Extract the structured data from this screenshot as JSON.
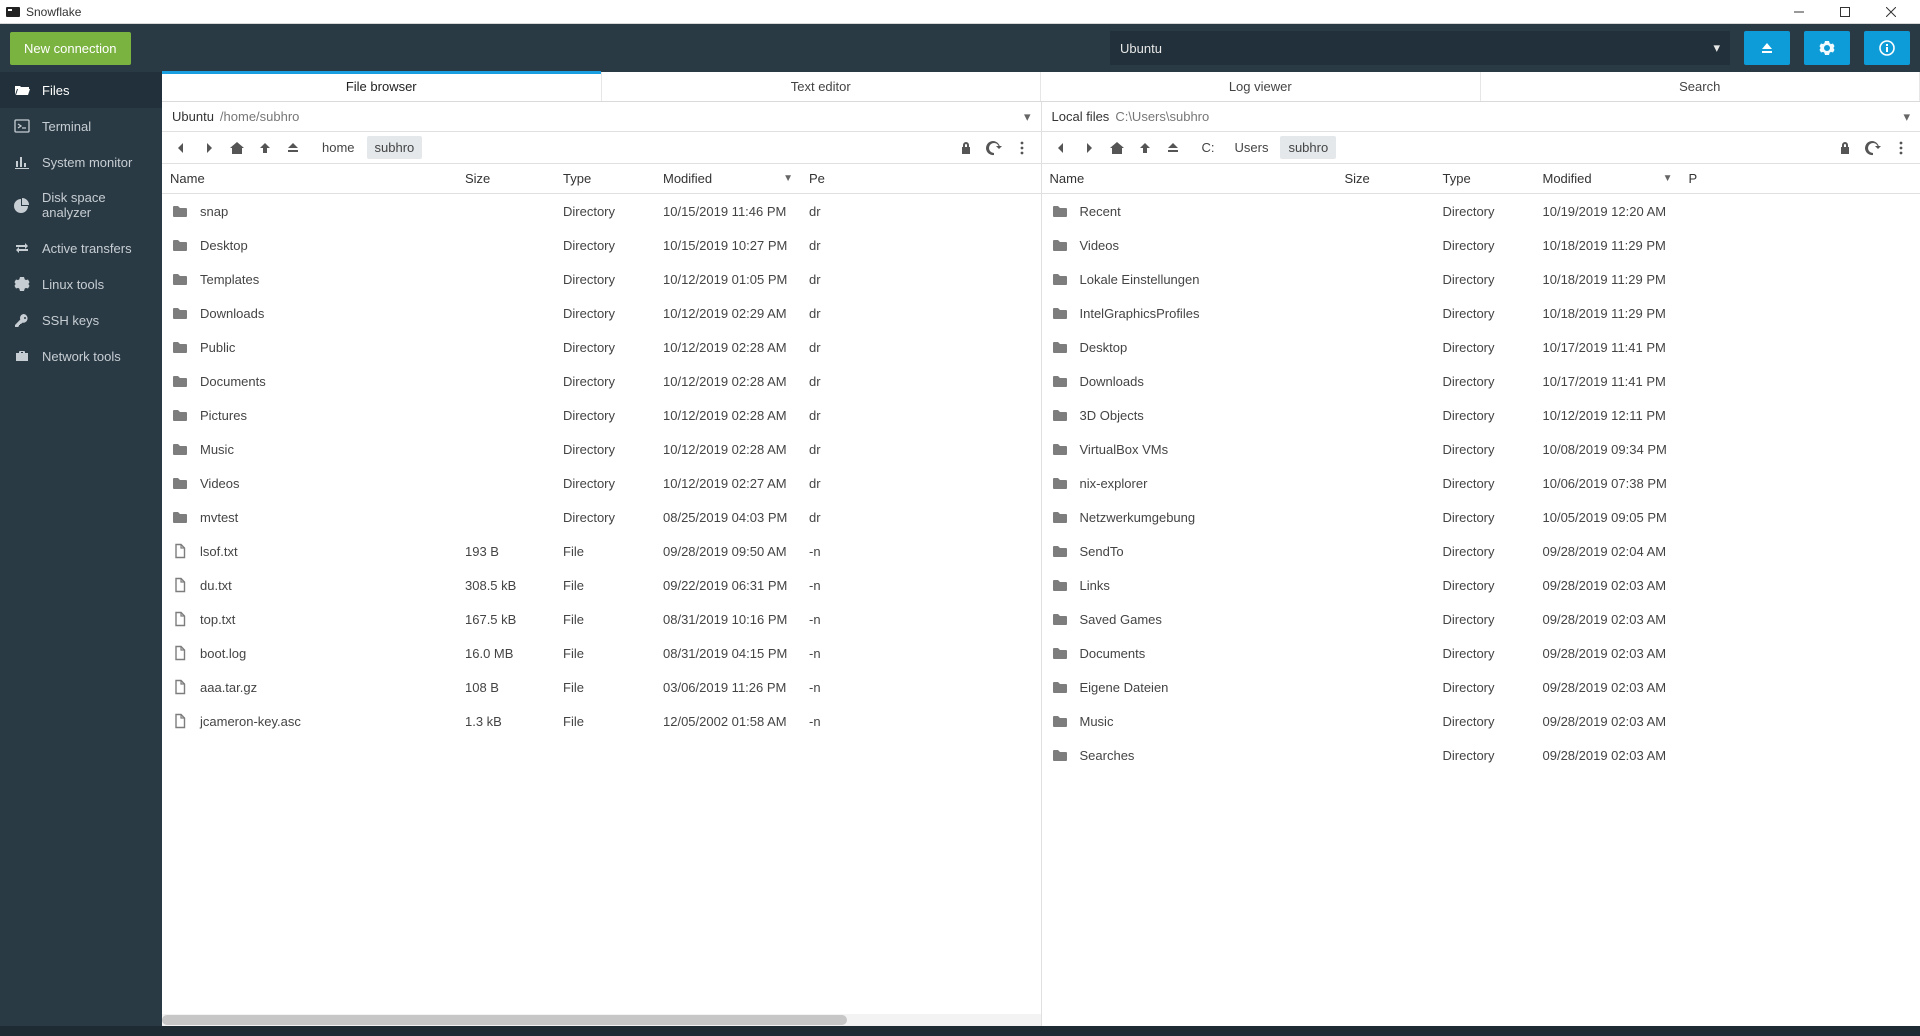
{
  "window": {
    "title": "Snowflake"
  },
  "topbar": {
    "new_connection_label": "New connection",
    "connection_name": "Ubuntu"
  },
  "sidebar": {
    "items": [
      {
        "label": "Files",
        "icon": "folder-open-icon"
      },
      {
        "label": "Terminal",
        "icon": "terminal-icon"
      },
      {
        "label": "System monitor",
        "icon": "bar-chart-icon"
      },
      {
        "label": "Disk space analyzer",
        "icon": "pie-chart-icon"
      },
      {
        "label": "Active transfers",
        "icon": "transfer-icon"
      },
      {
        "label": "Linux tools",
        "icon": "gear-icon"
      },
      {
        "label": "SSH keys",
        "icon": "key-icon"
      },
      {
        "label": "Network tools",
        "icon": "briefcase-icon"
      }
    ]
  },
  "tabs": [
    {
      "label": "File browser"
    },
    {
      "label": "Text editor"
    },
    {
      "label": "Log viewer"
    },
    {
      "label": "Search"
    }
  ],
  "columns": {
    "name": "Name",
    "size": "Size",
    "type": "Type",
    "modified": "Modified",
    "perm_left": "Pe",
    "perm_right": "P"
  },
  "panes": {
    "left": {
      "host": "Ubuntu",
      "path_display": "/home/subhro",
      "breadcrumbs": [
        "home",
        "subhro"
      ],
      "files": [
        {
          "name": "snap",
          "size": "",
          "type": "Directory",
          "modified": "10/15/2019 11:46 PM",
          "perm": "dr",
          "icon": "folder"
        },
        {
          "name": "Desktop",
          "size": "",
          "type": "Directory",
          "modified": "10/15/2019 10:27 PM",
          "perm": "dr",
          "icon": "folder"
        },
        {
          "name": "Templates",
          "size": "",
          "type": "Directory",
          "modified": "10/12/2019 01:05 PM",
          "perm": "dr",
          "icon": "folder"
        },
        {
          "name": "Downloads",
          "size": "",
          "type": "Directory",
          "modified": "10/12/2019 02:29 AM",
          "perm": "dr",
          "icon": "folder"
        },
        {
          "name": "Public",
          "size": "",
          "type": "Directory",
          "modified": "10/12/2019 02:28 AM",
          "perm": "dr",
          "icon": "folder"
        },
        {
          "name": "Documents",
          "size": "",
          "type": "Directory",
          "modified": "10/12/2019 02:28 AM",
          "perm": "dr",
          "icon": "folder"
        },
        {
          "name": "Pictures",
          "size": "",
          "type": "Directory",
          "modified": "10/12/2019 02:28 AM",
          "perm": "dr",
          "icon": "folder"
        },
        {
          "name": "Music",
          "size": "",
          "type": "Directory",
          "modified": "10/12/2019 02:28 AM",
          "perm": "dr",
          "icon": "folder"
        },
        {
          "name": "Videos",
          "size": "",
          "type": "Directory",
          "modified": "10/12/2019 02:27 AM",
          "perm": "dr",
          "icon": "folder"
        },
        {
          "name": "mvtest",
          "size": "",
          "type": "Directory",
          "modified": "08/25/2019 04:03 PM",
          "perm": "dr",
          "icon": "folder"
        },
        {
          "name": "lsof.txt",
          "size": "193 B",
          "type": "File",
          "modified": "09/28/2019 09:50 AM",
          "perm": "-n",
          "icon": "file"
        },
        {
          "name": "du.txt",
          "size": "308.5 kB",
          "type": "File",
          "modified": "09/22/2019 06:31 PM",
          "perm": "-n",
          "icon": "file"
        },
        {
          "name": "top.txt",
          "size": "167.5 kB",
          "type": "File",
          "modified": "08/31/2019 10:16 PM",
          "perm": "-n",
          "icon": "file"
        },
        {
          "name": "boot.log",
          "size": "16.0 MB",
          "type": "File",
          "modified": "08/31/2019 04:15 PM",
          "perm": "-n",
          "icon": "file"
        },
        {
          "name": "aaa.tar.gz",
          "size": "108 B",
          "type": "File",
          "modified": "03/06/2019 11:26 PM",
          "perm": "-n",
          "icon": "file"
        },
        {
          "name": "jcameron-key.asc",
          "size": "1.3 kB",
          "type": "File",
          "modified": "12/05/2002 01:58 AM",
          "perm": "-n",
          "icon": "file"
        }
      ]
    },
    "right": {
      "host": "Local files",
      "path_display": "C:\\Users\\subhro",
      "breadcrumbs": [
        "C:",
        "Users",
        "subhro"
      ],
      "files": [
        {
          "name": "Recent",
          "size": "",
          "type": "Directory",
          "modified": "10/19/2019 12:20 AM",
          "perm": "",
          "icon": "folder"
        },
        {
          "name": "Videos",
          "size": "",
          "type": "Directory",
          "modified": "10/18/2019 11:29 PM",
          "perm": "",
          "icon": "folder"
        },
        {
          "name": "Lokale Einstellungen",
          "size": "",
          "type": "Directory",
          "modified": "10/18/2019 11:29 PM",
          "perm": "",
          "icon": "folder"
        },
        {
          "name": "IntelGraphicsProfiles",
          "size": "",
          "type": "Directory",
          "modified": "10/18/2019 11:29 PM",
          "perm": "",
          "icon": "folder"
        },
        {
          "name": "Desktop",
          "size": "",
          "type": "Directory",
          "modified": "10/17/2019 11:41 PM",
          "perm": "",
          "icon": "folder"
        },
        {
          "name": "Downloads",
          "size": "",
          "type": "Directory",
          "modified": "10/17/2019 11:41 PM",
          "perm": "",
          "icon": "folder"
        },
        {
          "name": "3D Objects",
          "size": "",
          "type": "Directory",
          "modified": "10/12/2019 12:11 PM",
          "perm": "",
          "icon": "folder"
        },
        {
          "name": "VirtualBox VMs",
          "size": "",
          "type": "Directory",
          "modified": "10/08/2019 09:34 PM",
          "perm": "",
          "icon": "folder"
        },
        {
          "name": "nix-explorer",
          "size": "",
          "type": "Directory",
          "modified": "10/06/2019 07:38 PM",
          "perm": "",
          "icon": "folder"
        },
        {
          "name": "Netzwerkumgebung",
          "size": "",
          "type": "Directory",
          "modified": "10/05/2019 09:05 PM",
          "perm": "",
          "icon": "folder"
        },
        {
          "name": "SendTo",
          "size": "",
          "type": "Directory",
          "modified": "09/28/2019 02:04 AM",
          "perm": "",
          "icon": "folder"
        },
        {
          "name": "Links",
          "size": "",
          "type": "Directory",
          "modified": "09/28/2019 02:03 AM",
          "perm": "",
          "icon": "folder"
        },
        {
          "name": "Saved Games",
          "size": "",
          "type": "Directory",
          "modified": "09/28/2019 02:03 AM",
          "perm": "",
          "icon": "folder"
        },
        {
          "name": "Documents",
          "size": "",
          "type": "Directory",
          "modified": "09/28/2019 02:03 AM",
          "perm": "",
          "icon": "folder"
        },
        {
          "name": "Eigene Dateien",
          "size": "",
          "type": "Directory",
          "modified": "09/28/2019 02:03 AM",
          "perm": "",
          "icon": "folder"
        },
        {
          "name": "Music",
          "size": "",
          "type": "Directory",
          "modified": "09/28/2019 02:03 AM",
          "perm": "",
          "icon": "folder"
        },
        {
          "name": "Searches",
          "size": "",
          "type": "Directory",
          "modified": "09/28/2019 02:03 AM",
          "perm": "",
          "icon": "folder"
        }
      ]
    }
  }
}
